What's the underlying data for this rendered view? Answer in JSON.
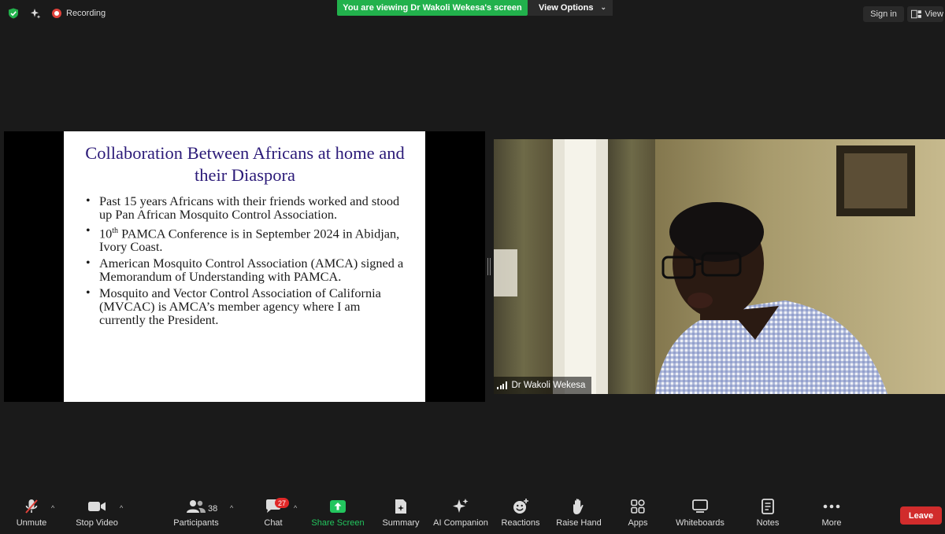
{
  "top": {
    "recording_label": "Recording",
    "viewing_banner": "You are viewing Dr Wakoli Wekesa's screen",
    "view_options_label": "View Options",
    "sign_in_label": "Sign in",
    "view_label": "View"
  },
  "slide": {
    "title": "Collaboration Between Africans at home and their Diaspora",
    "bullets": [
      "Past 15 years Africans with their friends worked and stood up Pan African Mosquito Control Association.",
      "Conference is in September 2024 in Abidjan, Ivory Coast.",
      "American Mosquito Control Association (AMCA) signed a Memorandum of Understanding with PAMCA.",
      "Mosquito and Vector Control Association of California (MVCAC) is AMCA’s member agency where I am currently the President."
    ],
    "bullet2_prefix": "10",
    "bullet2_sup": "th",
    "bullet2_org": "PAMCA"
  },
  "video": {
    "participant_name": "Dr Wakoli Wekesa"
  },
  "toolbar": {
    "unmute": "Unmute",
    "stop_video": "Stop Video",
    "participants": "Participants",
    "participant_count": "38",
    "chat": "Chat",
    "chat_badge": "27",
    "share_screen": "Share Screen",
    "summary": "Summary",
    "ai_companion": "AI Companion",
    "reactions": "Reactions",
    "raise_hand": "Raise Hand",
    "apps": "Apps",
    "whiteboards": "Whiteboards",
    "notes": "Notes",
    "more": "More",
    "leave": "Leave"
  },
  "colors": {
    "banner_green": "#22b14c",
    "leave_red": "#d12c2c",
    "slide_title": "#2b1a78",
    "share_icon_green": "#23c55e"
  }
}
